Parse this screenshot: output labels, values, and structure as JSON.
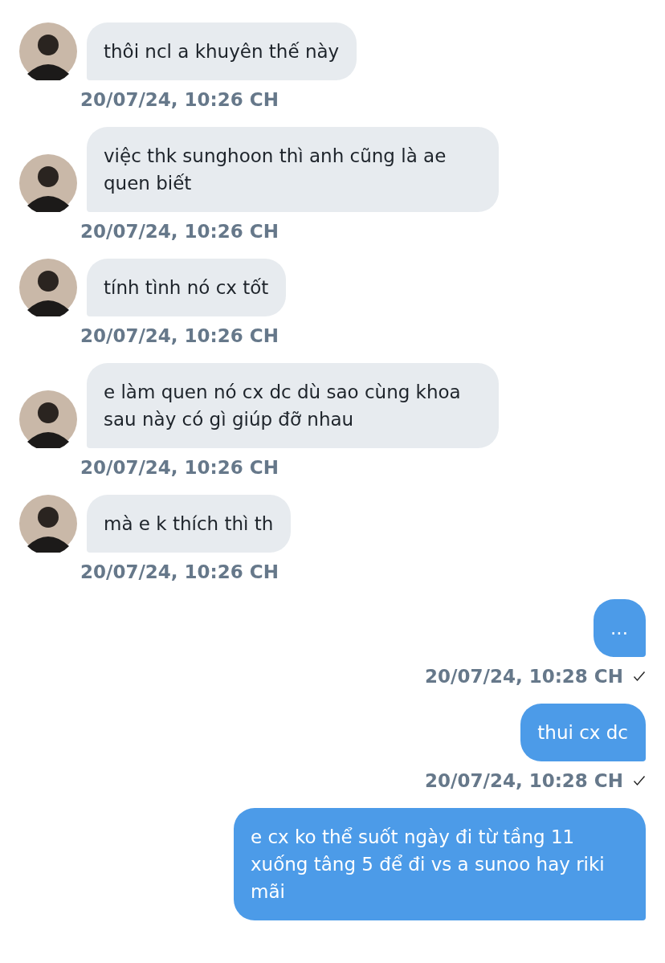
{
  "messages": [
    {
      "kind": "received",
      "text": "thôi ncl a khuyên thế này",
      "time": "20/07/24, 10:26 CH"
    },
    {
      "kind": "received",
      "text": "việc thk sunghoon thì anh cũng là ae quen biết",
      "time": "20/07/24, 10:26 CH"
    },
    {
      "kind": "received",
      "text": "tính tình nó cx tốt",
      "time": "20/07/24, 10:26 CH"
    },
    {
      "kind": "received",
      "text": "e làm quen nó cx dc dù sao cùng khoa sau này có gì giúp đỡ nhau",
      "time": "20/07/24, 10:26 CH"
    },
    {
      "kind": "received",
      "text": "mà e k thích thì th",
      "time": "20/07/24, 10:26 CH"
    },
    {
      "kind": "sent",
      "text": "...",
      "time": "20/07/24, 10:28 CH",
      "delivered": true
    },
    {
      "kind": "sent",
      "text": "thui cx dc",
      "time": "20/07/24, 10:28 CH",
      "delivered": true
    },
    {
      "kind": "sent",
      "text": "e cx ko thể suốt ngày đi từ tầng 11 xuống tâng 5 để đi vs a sunoo hay riki mãi"
    }
  ]
}
